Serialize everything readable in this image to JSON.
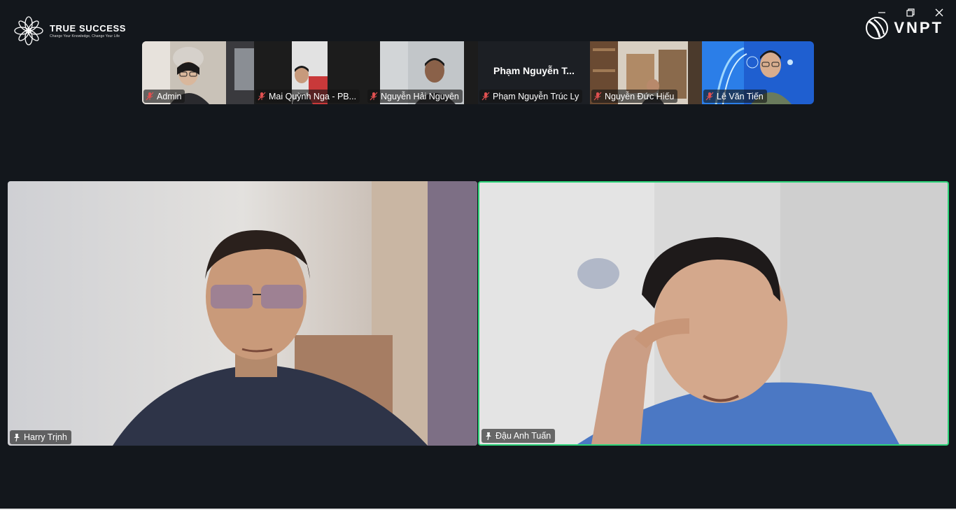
{
  "branding": {
    "name": "TRUE SUCCESS",
    "tagline": "Change Your Knowledge, Change Your Life",
    "partner": "VNPT"
  },
  "window_controls": [
    "minimize-icon",
    "restore-icon",
    "close-icon"
  ],
  "thumbnails": [
    {
      "name": "Admin",
      "muted": true
    },
    {
      "name": "Mai Quỳnh Nga - PB...",
      "muted": true
    },
    {
      "name": "Nguyễn Hải Nguyên",
      "muted": true
    },
    {
      "name": "Phạm Nguyễn Trúc Ly",
      "display_title": "Phạm  Nguyễn  T...",
      "muted": true
    },
    {
      "name": "Nguyễn Đức Hiếu",
      "muted": true
    },
    {
      "name": "Lê Văn Tiến",
      "muted": true
    }
  ],
  "main_tiles": [
    {
      "name": "Harry Trịnh",
      "pinned": true,
      "active_speaker": false
    },
    {
      "name": "Đậu Anh Tuấn",
      "pinned": true,
      "active_speaker": true
    }
  ],
  "colors": {
    "background": "#13171c",
    "active_speaker_border": "#2ed47a",
    "muted_icon": "#e05050"
  }
}
